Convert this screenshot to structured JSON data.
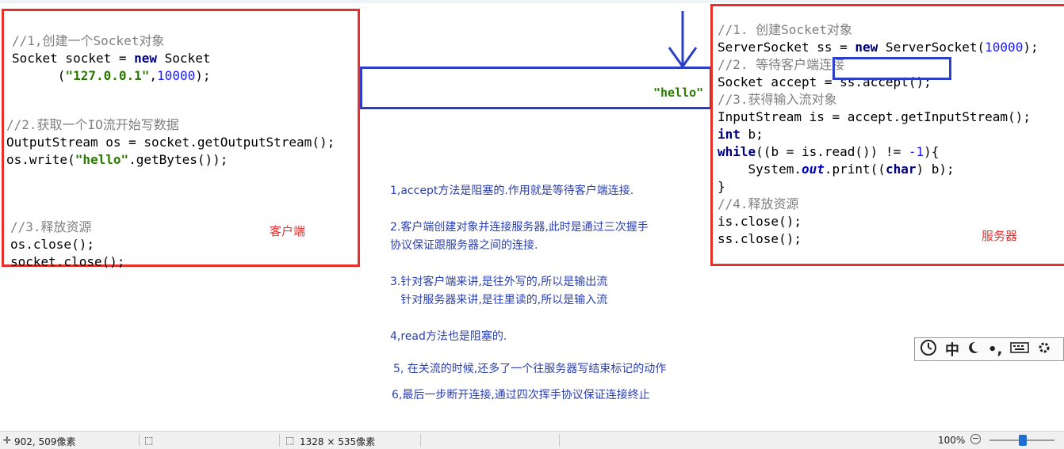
{
  "client": {
    "c1": "//1,创建一个Socket对象",
    "l1": [
      "Socket socket = ",
      "new",
      " Socket"
    ],
    "l2": [
      "      (",
      "\"127.0.0.1\"",
      ",",
      "10000",
      ");"
    ],
    "c2": "//2.获取一个IO流开始写数据",
    "l3": "OutputStream os = socket.getOutputStream();",
    "l4": [
      "os.write(",
      "\"hello\"",
      ".getBytes());"
    ],
    "c3": "//3.释放资源",
    "l5": "os.close();",
    "l6": "socket.close();",
    "label": "客户端"
  },
  "server": {
    "c1": "//1. 创建Socket对象",
    "l1": [
      "ServerSocket ss = ",
      "new",
      " ServerSocket(",
      "10000",
      ");"
    ],
    "c2": "//2. 等待客户端连接",
    "l2a": "Socket accept = ",
    "l2b": "ss.accept();",
    "c3": "//3.获得输入流对象",
    "l3": "InputStream is = accept.getInputStream();",
    "l4": [
      "int",
      " b;"
    ],
    "l5": [
      "while",
      "((b = is.read()) != ",
      "-1",
      "){"
    ],
    "l6": [
      "    System.",
      "out",
      ".print((",
      "char",
      ") b);"
    ],
    "l7": "}",
    "c4": "//4.释放资源",
    "l8": "is.close();",
    "l9": "ss.close();",
    "label": "服务器"
  },
  "channel_text": "\"hello\"",
  "notes": [
    "1,accept方法是阻塞的.作用就是等待客户端连接.",
    "2.客户端创建对象并连接服务器,此时是通过三次握手",
    "协议保证跟服务器之间的连接.",
    "3.针对客户端来讲,是往外写的,所以是输出流",
    "   针对服务器来讲,是往里读的,所以是输入流",
    "4,read方法也是阻塞的.",
    "5, 在关流的时候,还多了一个往服务器写结束标记的动作",
    "6,最后一步断开连接,通过四次挥手协议保证连接终止"
  ],
  "ime": {
    "icons": [
      "clock-icon",
      "moon-icon",
      "punctuation-icon",
      "keyboard-icon",
      "gear-icon"
    ],
    "mode": "中",
    "dot": "•,"
  },
  "status": {
    "cursor_pos": "902, 509像素",
    "selection_size": "1328 × 535像素",
    "zoom": "100%",
    "zoom_out": "−"
  },
  "colors": {
    "red_box": "#e8302a",
    "blue_box": "#2b3fc7",
    "note_text": "#2a3fb0"
  }
}
